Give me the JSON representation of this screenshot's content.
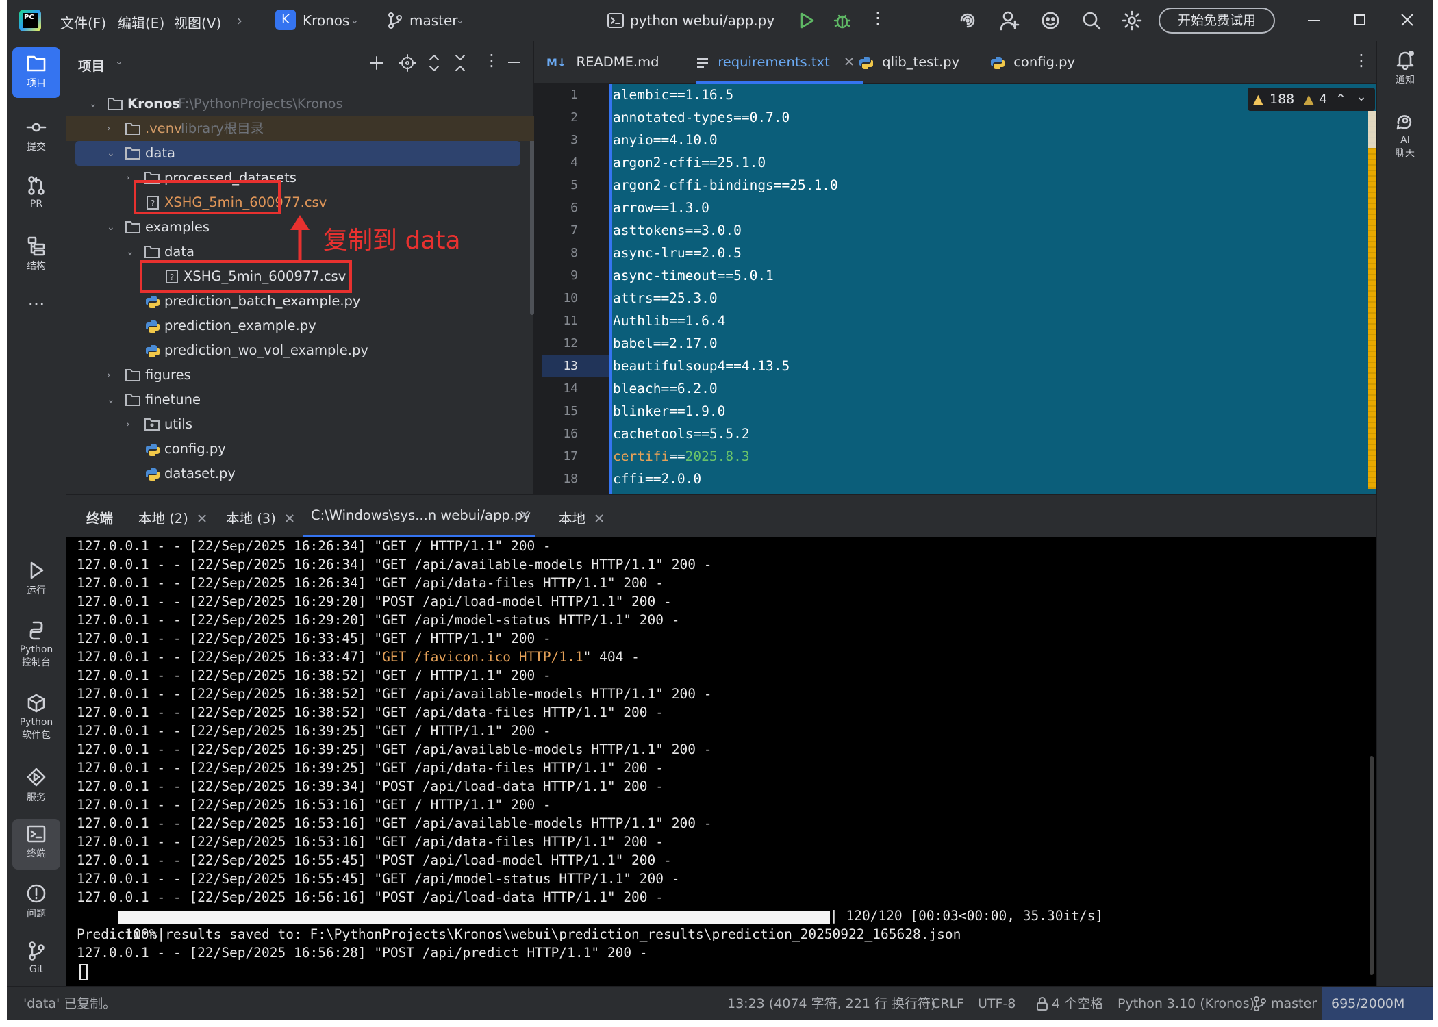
{
  "title_bar": {
    "menus": [
      "文件(F)",
      "编辑(E)",
      "视图(V)"
    ],
    "project_badge": "K",
    "project_name": "Kronos",
    "branch": "master",
    "run_config": "python webui/app.py",
    "trial_button": "开始免费试用"
  },
  "left_stripe": {
    "project": "项目",
    "commit": "提交",
    "pr": "PR",
    "structure": "结构",
    "run": "运行",
    "python_console": "Python\n控制台",
    "python_packages": "Python\n软件包",
    "services": "服务",
    "terminal": "终端",
    "problems": "问题",
    "git": "Git"
  },
  "right_stripe": {
    "notifications": "通知",
    "ai_chat": "AI\n聊天"
  },
  "project_panel": {
    "title": "项目",
    "tree": [
      {
        "label": "Kronos",
        "hint": "F:\\PythonProjects\\Kronos"
      },
      {
        "label": ".venv",
        "hint": "library根目录"
      },
      {
        "label": "data"
      },
      {
        "label": "processed_datasets"
      },
      {
        "label": "XSHG_5min_600977.csv"
      },
      {
        "label": "examples"
      },
      {
        "label": "data"
      },
      {
        "label": "XSHG_5min_600977.csv"
      },
      {
        "label": "prediction_batch_example.py"
      },
      {
        "label": "prediction_example.py"
      },
      {
        "label": "prediction_wo_vol_example.py"
      },
      {
        "label": "figures"
      },
      {
        "label": "finetune"
      },
      {
        "label": "utils"
      },
      {
        "label": "config.py"
      },
      {
        "label": "dataset.py"
      }
    ]
  },
  "annotation": {
    "text": "复制到 data",
    "color": "#e8312f"
  },
  "editor": {
    "tabs": [
      "README.md",
      "requirements.txt",
      "qlib_test.py",
      "config.py"
    ],
    "active_tab": "requirements.txt",
    "inspection": {
      "warnings": "188",
      "weak_warnings": "4"
    },
    "current_line": 13,
    "lines": [
      "alembic==1.16.5",
      "annotated-types==0.7.0",
      "anyio==4.10.0",
      "argon2-cffi==25.1.0",
      "argon2-cffi-bindings==25.1.0",
      "arrow==1.3.0",
      "asttokens==3.0.0",
      "async-lru==2.0.5",
      "async-timeout==5.0.1",
      "attrs==25.3.0",
      "Authlib==1.6.4",
      "babel==2.17.0",
      "beautifulsoup4==4.13.5",
      "bleach==6.2.0",
      "blinker==1.9.0",
      "cachetools==5.5.2",
      "certifi==2025.8.3",
      "cffi==2.0.0"
    ],
    "line_numbers": [
      "1",
      "2",
      "3",
      "4",
      "5",
      "6",
      "7",
      "8",
      "9",
      "10",
      "11",
      "12",
      "13",
      "14",
      "15",
      "16",
      "17",
      "18"
    ]
  },
  "terminal": {
    "title": "终端",
    "tabs": [
      "本地 (2)",
      "本地 (3)",
      "C:\\Windows\\sys...n webui/app.py",
      "本地"
    ],
    "lines": [
      "127.0.0.1 - - [22/Sep/2025 16:26:34] \"GET / HTTP/1.1\" 200 -",
      "127.0.0.1 - - [22/Sep/2025 16:26:34] \"GET /api/available-models HTTP/1.1\" 200 -",
      "127.0.0.1 - - [22/Sep/2025 16:26:34] \"GET /api/data-files HTTP/1.1\" 200 -",
      "127.0.0.1 - - [22/Sep/2025 16:29:20] \"POST /api/load-model HTTP/1.1\" 200 -",
      "127.0.0.1 - - [22/Sep/2025 16:29:20] \"GET /api/model-status HTTP/1.1\" 200 -",
      "127.0.0.1 - - [22/Sep/2025 16:33:45] \"GET / HTTP/1.1\" 200 -",
      "127.0.0.1 - - [22/Sep/2025 16:33:47] \"GET /favicon.ico HTTP/1.1\" 404 -",
      "127.0.0.1 - - [22/Sep/2025 16:38:52] \"GET / HTTP/1.1\" 200 -",
      "127.0.0.1 - - [22/Sep/2025 16:38:52] \"GET /api/available-models HTTP/1.1\" 200 -",
      "127.0.0.1 - - [22/Sep/2025 16:38:52] \"GET /api/data-files HTTP/1.1\" 200 -",
      "127.0.0.1 - - [22/Sep/2025 16:39:25] \"GET / HTTP/1.1\" 200 -",
      "127.0.0.1 - - [22/Sep/2025 16:39:25] \"GET /api/available-models HTTP/1.1\" 200 -",
      "127.0.0.1 - - [22/Sep/2025 16:39:25] \"GET /api/data-files HTTP/1.1\" 200 -",
      "127.0.0.1 - - [22/Sep/2025 16:39:34] \"POST /api/load-data HTTP/1.1\" 200 -",
      "127.0.0.1 - - [22/Sep/2025 16:53:16] \"GET / HTTP/1.1\" 200 -",
      "127.0.0.1 - - [22/Sep/2025 16:53:16] \"GET /api/available-models HTTP/1.1\" 200 -",
      "127.0.0.1 - - [22/Sep/2025 16:53:16] \"GET /api/data-files HTTP/1.1\" 200 -",
      "127.0.0.1 - - [22/Sep/2025 16:55:45] \"POST /api/load-model HTTP/1.1\" 200 -",
      "127.0.0.1 - - [22/Sep/2025 16:55:45] \"GET /api/model-status HTTP/1.1\" 200 -",
      "127.0.0.1 - - [22/Sep/2025 16:56:16] \"POST /api/load-data HTTP/1.1\" 200 -"
    ],
    "favicon_line": {
      "prefix": "127.0.0.1 - - [22/Sep/2025 16:33:47] \"",
      "highlight": "GET /favicon.ico HTTP/1.1",
      "suffix": "\" 404 -"
    },
    "progress": {
      "prefix": "100%|",
      "fraction": 1.0,
      "suffix": "| 120/120 [00:03<00:00, 35.30it/s]"
    },
    "saved_line": "Prediction results saved to: F:\\PythonProjects\\Kronos\\webui\\prediction_results\\prediction_20250922_165628.json",
    "predict_line": "127.0.0.1 - - [22/Sep/2025 16:56:28] \"POST /api/predict HTTP/1.1\" 200 -"
  },
  "status_bar": {
    "message": "'data' 已复制。",
    "position": "13:23 (4074 字符, 221 行 换行符)",
    "line_sep": "CRLF",
    "encoding": "UTF-8",
    "indent": "4 个空格",
    "interpreter": "Python 3.10 (Kronos)",
    "branch": "master",
    "memory": "695/2000M"
  },
  "colors": {
    "ide_bg": "#2b2d30",
    "editor_selection": "#0b5e7a",
    "accent": "#3574f0",
    "annotation_red": "#e8312f",
    "warning": "#f2c55c"
  }
}
